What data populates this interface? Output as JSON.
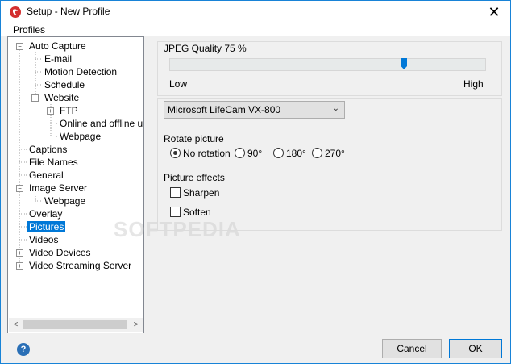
{
  "window": {
    "title": "Setup - New Profile",
    "close_glyph": "✕"
  },
  "menu": {
    "profiles": "Profiles"
  },
  "tree": {
    "auto_capture": "Auto Capture",
    "email": "E-mail",
    "motion_detection": "Motion Detection",
    "schedule": "Schedule",
    "website": "Website",
    "ftp": "FTP",
    "online_offline": "Online and offline uplc",
    "webpage": "Webpage",
    "captions": "Captions",
    "file_names": "File Names",
    "general": "General",
    "image_server": "Image Server",
    "image_server_webpage": "Webpage",
    "overlay": "Overlay",
    "pictures": "Pictures",
    "videos": "Videos",
    "video_devices": "Video Devices",
    "video_streaming_server": "Video Streaming Server",
    "selected": "Pictures",
    "expander_minus": "−",
    "expander_plus": "+"
  },
  "scroll": {
    "left": "<",
    "right": ">"
  },
  "jpeg": {
    "label": "JPEG Quality 75 %",
    "quality_percent": 75,
    "low": "Low",
    "high": "High"
  },
  "camera": {
    "selected": "Microsoft LifeCam VX-800",
    "arrow": "⌄"
  },
  "rotate": {
    "label": "Rotate picture",
    "options": [
      "No rotation",
      "90°",
      "180°",
      "270°"
    ],
    "selected": "No rotation"
  },
  "effects": {
    "label": "Picture effects",
    "sharpen": "Sharpen",
    "soften": "Soften"
  },
  "buttons": {
    "cancel": "Cancel",
    "ok": "OK",
    "help": "?"
  },
  "watermark": "SOFTPEDIA"
}
